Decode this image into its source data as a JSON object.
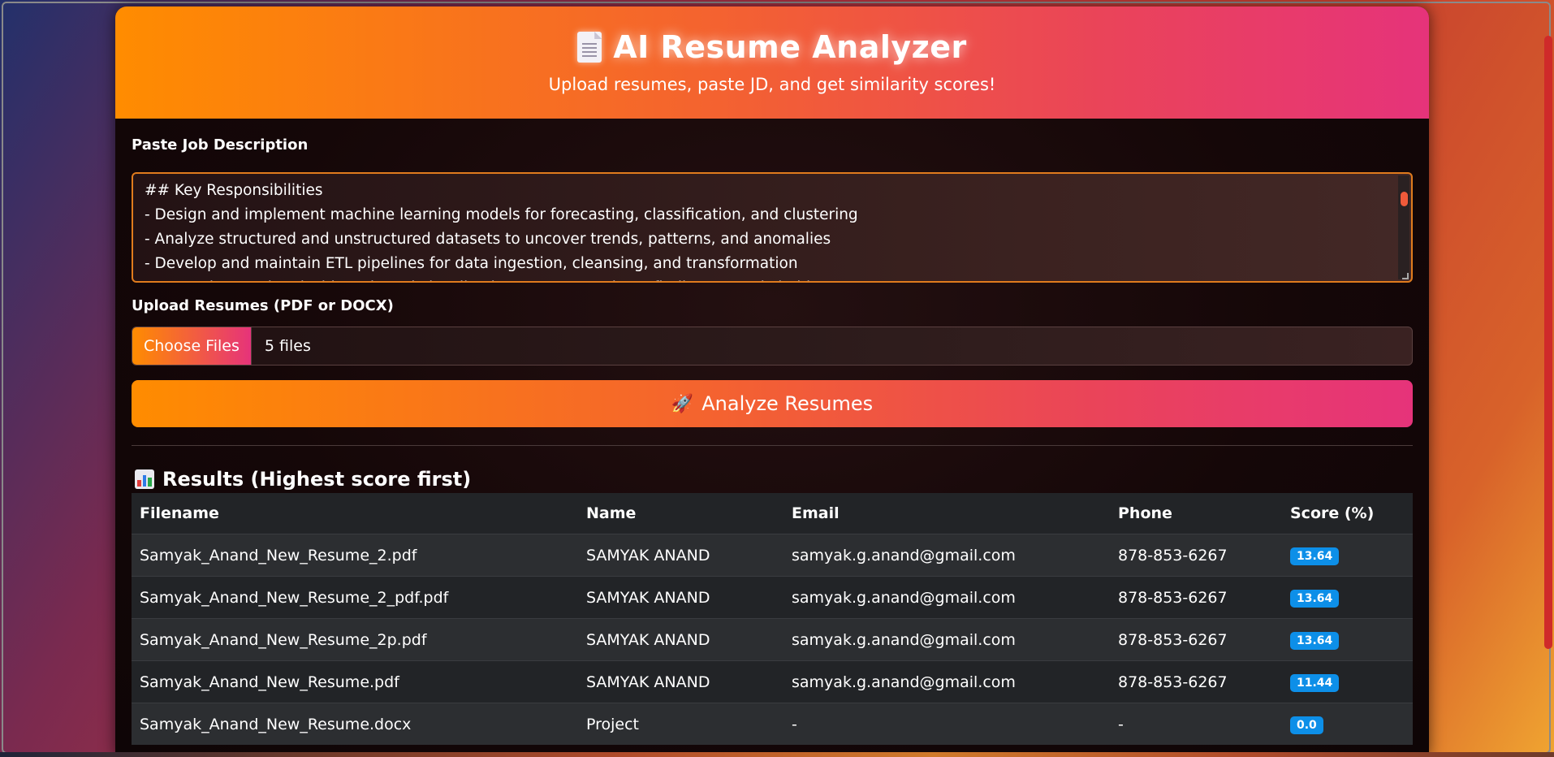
{
  "header": {
    "title": "AI Resume Analyzer",
    "subtitle": "Upload resumes, paste JD, and get similarity scores!"
  },
  "job_description": {
    "label": "Paste Job Description",
    "lines": [
      "## Key Responsibilities",
      "- Design and implement machine learning models for forecasting, classification, and clustering",
      "- Analyze structured and unstructured datasets to uncover trends, patterns, and anomalies",
      "- Develop and maintain ETL pipelines for data ingestion, cleansing, and transformation",
      "- Create interactive dashboards and visualizations to communicate findings to stakeholders"
    ]
  },
  "upload": {
    "label": "Upload Resumes (PDF or DOCX)",
    "button_label": "Choose Files",
    "file_count": "5 files"
  },
  "analyze": {
    "label": "Analyze Resumes"
  },
  "results": {
    "title": "Results (Highest score first)",
    "columns": [
      "Filename",
      "Name",
      "Email",
      "Phone",
      "Score (%)"
    ],
    "rows": [
      {
        "filename": "Samyak_Anand_New_Resume_2.pdf",
        "name": "SAMYAK ANAND",
        "email": "samyak.g.anand@gmail.com",
        "phone": "878-853-6267",
        "score": "13.64"
      },
      {
        "filename": "Samyak_Anand_New_Resume_2_pdf.pdf",
        "name": "SAMYAK ANAND",
        "email": "samyak.g.anand@gmail.com",
        "phone": "878-853-6267",
        "score": "13.64"
      },
      {
        "filename": "Samyak_Anand_New_Resume_2p.pdf",
        "name": "SAMYAK ANAND",
        "email": "samyak.g.anand@gmail.com",
        "phone": "878-853-6267",
        "score": "13.64"
      },
      {
        "filename": "Samyak_Anand_New_Resume.pdf",
        "name": "SAMYAK ANAND",
        "email": "samyak.g.anand@gmail.com",
        "phone": "878-853-6267",
        "score": "11.44"
      },
      {
        "filename": "Samyak_Anand_New_Resume.docx",
        "name": "Project",
        "email": "-",
        "phone": "-",
        "score": "0.0"
      }
    ]
  },
  "colors": {
    "accent_start": "#ff8c00",
    "accent_end": "#e6337a",
    "score_badge": "#0d8fe8"
  },
  "icons": {
    "title": "document-icon",
    "analyze": "rocket-icon",
    "results": "bar-chart-icon"
  }
}
